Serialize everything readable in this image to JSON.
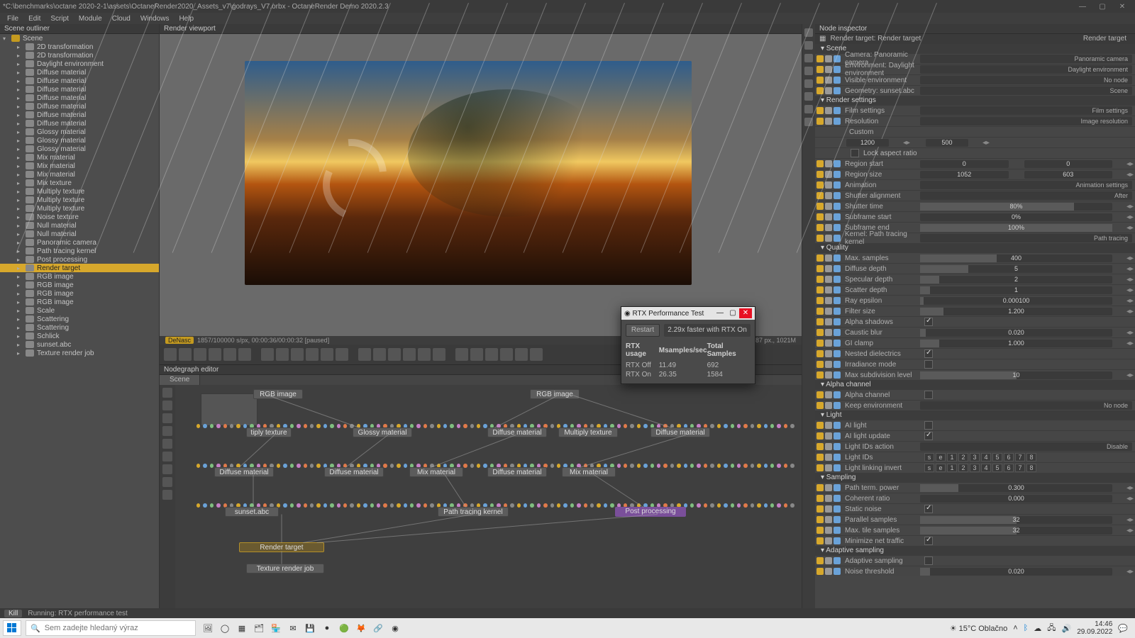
{
  "window": {
    "title": "*C:\\benchmarks\\octane 2020-2-1\\assets\\OctaneRender2020_Assets_v7\\godrays_V7.orbx - OctaneRender Demo 2020.2.3",
    "menus": [
      "File",
      "Edit",
      "Script",
      "Module",
      "Cloud",
      "Windows",
      "Help"
    ]
  },
  "outliner": {
    "header": "Scene outliner",
    "root": "Scene",
    "items": [
      "2D transformation",
      "2D transformation",
      "Daylight environment",
      "Diffuse material",
      "Diffuse material",
      "Diffuse material",
      "Diffuse material",
      "Diffuse material",
      "Diffuse material",
      "Diffuse material",
      "Glossy material",
      "Glossy material",
      "Glossy material",
      "Mix material",
      "Mix material",
      "Mix material",
      "Mix texture",
      "Multiply texture",
      "Multiply texture",
      "Multiply texture",
      "Noise texture",
      "Null material",
      "Null material",
      "Panoramic camera",
      "Path tracing kernel",
      "Post processing",
      "Render target",
      "RGB image",
      "RGB image",
      "RGB image",
      "RGB image",
      "Scale",
      "Scattering",
      "Scattering",
      "Schlick",
      "sunset.abc",
      "Texture render job"
    ],
    "selected_index": 26
  },
  "viewport": {
    "header": "Render viewport",
    "status_left_chip": "DeNasc",
    "status_left": "1857/100000 s/px, 00:00:36/00:00:32 [paused]",
    "status_right": "2 tex., 740087 px., 1021M"
  },
  "dialog": {
    "title": "RTX Performance Test",
    "restart": "Restart",
    "summary": "2.29x faster with RTX On",
    "headers": [
      "RTX usage",
      "Msamples/sec",
      "Total Samples"
    ],
    "rows": [
      {
        "u": "RTX Off",
        "ms": "11.49",
        "ts": "692"
      },
      {
        "u": "RTX On",
        "ms": "26.35",
        "ts": "1584"
      }
    ]
  },
  "nodegraph": {
    "header": "Nodegraph editor",
    "tab": "Scene",
    "nodes": {
      "rgb1": "RGB image",
      "rgb2": "RGB image",
      "glossy": "Glossy material",
      "diff1": "Diffuse material",
      "diff2": "Diffuse material",
      "diff3": "Diffuse material",
      "diff4": "Diffuse material",
      "mix1": "Mix material",
      "mix2": "Mix material",
      "mult": "Multiply texture",
      "tplytex": "tiply texture",
      "sunset": "sunset.abc",
      "path": "Path tracing kernel",
      "post": "Post processing",
      "target": "Render target",
      "job": "Texture render job"
    }
  },
  "inspector": {
    "header": "Node inspector",
    "target_label": "Render target: Render target",
    "target_button": "Render target",
    "scene": {
      "header": "Scene",
      "camera": {
        "l": "Camera: Panoramic camera",
        "v": "Panoramic camera"
      },
      "env": {
        "l": "Environment: Daylight environment",
        "v": "Daylight environment"
      },
      "visenv": {
        "l": "Visible environment",
        "v": "No node"
      },
      "geom": {
        "l": "Geometry: sunset.abc",
        "v": "Scene"
      }
    },
    "render": {
      "header": "Render settings",
      "film": {
        "l": "Film settings",
        "v": "Film settings"
      },
      "res": {
        "l": "Resolution",
        "v": "Image resolution"
      },
      "preset": "Custom",
      "w": "1200",
      "h": "500",
      "lock": "Lock aspect ratio",
      "region_start": {
        "l": "Region start",
        "a": "0",
        "b": "0"
      },
      "region_size": {
        "l": "Region size",
        "a": "1052",
        "b": "603"
      },
      "anim": {
        "l": "Animation",
        "v": "Animation settings"
      },
      "shutter_align": {
        "l": "Shutter alignment",
        "v": "After"
      },
      "shutter_time": {
        "l": "Shutter time",
        "v": "80%"
      },
      "subframe_start": {
        "l": "Subframe start",
        "v": "0%"
      },
      "subframe_end": {
        "l": "Subframe end",
        "v": "100%"
      },
      "kernel": {
        "l": "Kernel: Path tracing kernel",
        "v": "Path tracing"
      }
    },
    "quality": {
      "header": "Quality",
      "props": [
        {
          "l": "Max. samples",
          "v": "400",
          "f": 0.4
        },
        {
          "l": "Diffuse depth",
          "v": "5",
          "f": 0.25
        },
        {
          "l": "Specular depth",
          "v": "2",
          "f": 0.1
        },
        {
          "l": "Scatter depth",
          "v": "1",
          "f": 0.05
        },
        {
          "l": "Ray epsilon",
          "v": "0.000100",
          "f": 0.02
        },
        {
          "l": "Filter size",
          "v": "1.200",
          "f": 0.12
        },
        {
          "l": "Alpha shadows",
          "chk": true
        },
        {
          "l": "Caustic blur",
          "v": "0.020",
          "f": 0.03
        },
        {
          "l": "GI clamp",
          "v": "1.000",
          "f": 0.1
        },
        {
          "l": "Nested dielectrics",
          "chk": true
        },
        {
          "l": "Irradiance mode",
          "chk": false
        },
        {
          "l": "Max subdivision level",
          "v": "10",
          "f": 0.5
        }
      ]
    },
    "alpha": {
      "header": "Alpha channel",
      "a": {
        "l": "Alpha channel",
        "chk": false
      },
      "b": {
        "l": "Keep environment",
        "v": "No node"
      }
    },
    "light": {
      "header": "Light",
      "a": {
        "l": "AI light",
        "chk": false
      },
      "b": {
        "l": "AI light update",
        "chk": true
      },
      "c": {
        "l": "Light IDs action",
        "v": "Disable"
      },
      "ids_label": "Light IDs",
      "ids": [
        "s",
        "e",
        "1",
        "2",
        "3",
        "4",
        "5",
        "6",
        "7",
        "8"
      ],
      "mask_label": "Light linking invert",
      "mask": [
        "s",
        "e",
        "1",
        "2",
        "3",
        "4",
        "5",
        "6",
        "7",
        "8"
      ]
    },
    "sampling": {
      "header": "Sampling",
      "props": [
        {
          "l": "Path term. power",
          "v": "0.300",
          "f": 0.2
        },
        {
          "l": "Coherent ratio",
          "v": "0.000",
          "f": 0.0
        },
        {
          "l": "Static noise",
          "chk": true
        },
        {
          "l": "Parallel samples",
          "v": "32",
          "f": 0.5
        },
        {
          "l": "Max. tile samples",
          "v": "32",
          "f": 0.5
        },
        {
          "l": "Minimize net traffic",
          "chk": true
        }
      ]
    },
    "adaptive": {
      "header": "Adaptive sampling",
      "props": [
        {
          "l": "Adaptive sampling",
          "chk": false
        },
        {
          "l": "Noise threshold",
          "v": "0.020",
          "f": 0.05
        }
      ]
    }
  },
  "statusbar": {
    "kill": "Kill",
    "text": "Running: RTX performance test"
  },
  "taskbar": {
    "search_placeholder": "Sem zadejte hledaný výraz",
    "weather": "15°C  Oblačno",
    "time": "14:46",
    "date": "29.09.2022"
  }
}
